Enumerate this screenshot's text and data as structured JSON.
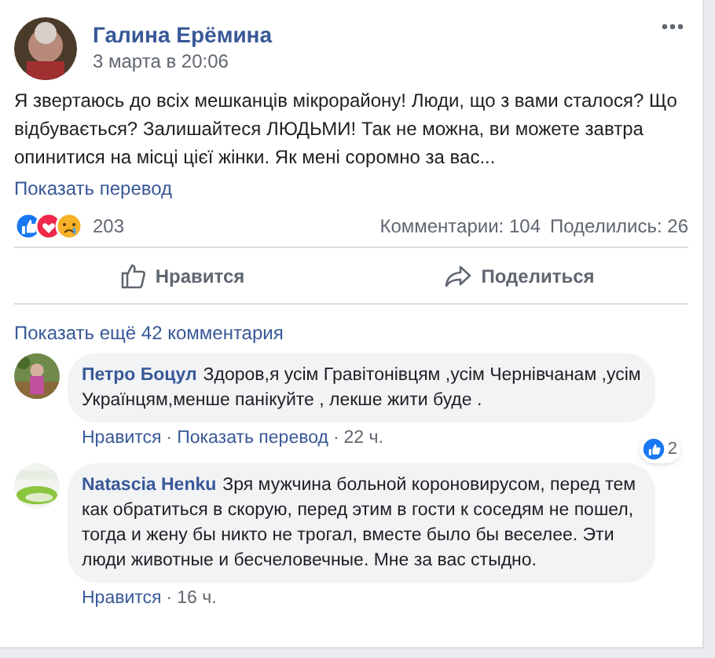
{
  "post": {
    "author": "Галина Ерёмина",
    "time": "3 марта в 20:06",
    "text": "Я звертаюсь до всіх мешканців мікрорайону! Люди, що з вами сталося? Що відбувається? Залишайтеся ЛЮДЬМИ! Так не можна, ви можете завтра опинитися на місці цієї жінки. Як мені соромно за вас...",
    "translate": "Показать перевод"
  },
  "stats": {
    "reactions": "203",
    "comments": "Комментарии: 104",
    "shares": "Поделились: 26"
  },
  "actions": [
    {
      "kind": "like",
      "label": "Нравится"
    },
    {
      "kind": "share",
      "label": "Поделиться"
    }
  ],
  "more_comments": "Показать ещё 42 комментария",
  "comments": [
    {
      "author": "Петро Боцул",
      "text": "Здоров,я усім Гравітонівцям ,усім Чернівчанам ,усім Українцям,менше панікуйте , лекше жити буде .",
      "links": [
        "Нравится",
        "Показать перевод",
        "22 ч."
      ],
      "separator": "·",
      "likes": "2"
    },
    {
      "author": "Natascia Henku",
      "text": "Зря мужчина больной короновирусом, перед тем как обратиться в скорую, перед этим в гости к соседям не пошел, тогда и жену бы никто не трогал, вместе было бы веселее. Эти люди животные и бесчеловечные. Мне за вас стыдно.",
      "links": [
        "Нравится",
        "16 ч."
      ],
      "separator": "·"
    }
  ]
}
